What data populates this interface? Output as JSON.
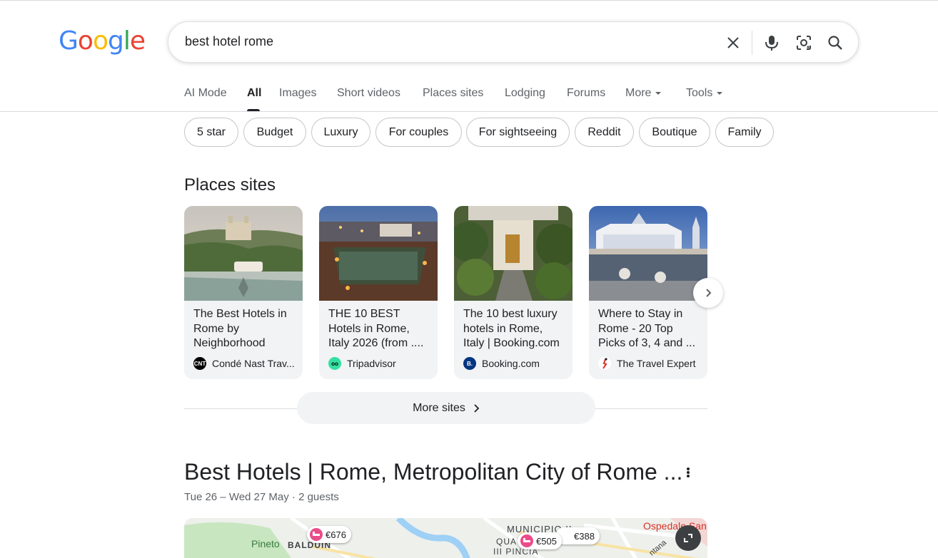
{
  "logo": [
    "G",
    "o",
    "o",
    "g",
    "l",
    "e"
  ],
  "search": {
    "query": "best hotel rome",
    "icons": [
      "close-icon",
      "microphone-icon",
      "lens-icon",
      "search-icon"
    ]
  },
  "tabs": [
    {
      "label": "AI Mode"
    },
    {
      "label": "All",
      "active": true
    },
    {
      "label": "Images"
    },
    {
      "label": "Short videos"
    },
    {
      "label": "Places sites"
    },
    {
      "label": "Lodging"
    },
    {
      "label": "Forums"
    },
    {
      "label": "More"
    },
    {
      "label": "Tools"
    }
  ],
  "chips": [
    "5 star",
    "Budget",
    "Luxury",
    "For couples",
    "For sightseeing",
    "Reddit",
    "Boutique",
    "Family"
  ],
  "places_sites": {
    "title": "Places sites",
    "cards": [
      {
        "title": "The Best Hotels in Rome by Neighborhood",
        "source": "Condé Nast Trav...",
        "favicon_text": "CNT",
        "favicon_color": "#000000"
      },
      {
        "title": "THE 10 BEST Hotels in Rome, Italy 2026 (from ....",
        "source": "Tripadvisor",
        "favicon_text": "oo",
        "favicon_color": "#34e0a1"
      },
      {
        "title": "The 10 best luxury hotels in Rome, Italy | Booking.com",
        "source": "Booking.com",
        "favicon_text": "B.",
        "favicon_color": "#003580"
      },
      {
        "title": "Where to Stay in Rome - 20 Top Picks of 3, 4 and ...",
        "source": "The Travel Expert",
        "favicon_text": "",
        "favicon_color": "#ffffff"
      }
    ],
    "more_label": "More sites"
  },
  "hotels": {
    "title": "Best Hotels | Rome, Metropolitan City of Rome ...",
    "subtitle": "Tue 26 – Wed 27 May · 2 guests",
    "map": {
      "labels": [
        "Pineto",
        "BALDUIN",
        "MUNICIPIO II",
        "QUA",
        "III PINCIA",
        "Ospedale San",
        "ntana"
      ],
      "prices": [
        "€676",
        "€505",
        "€388"
      ]
    }
  },
  "colors": {
    "accent": "#1a73e8",
    "pin": "#ea4c89",
    "hospital_label": "#d93025"
  }
}
